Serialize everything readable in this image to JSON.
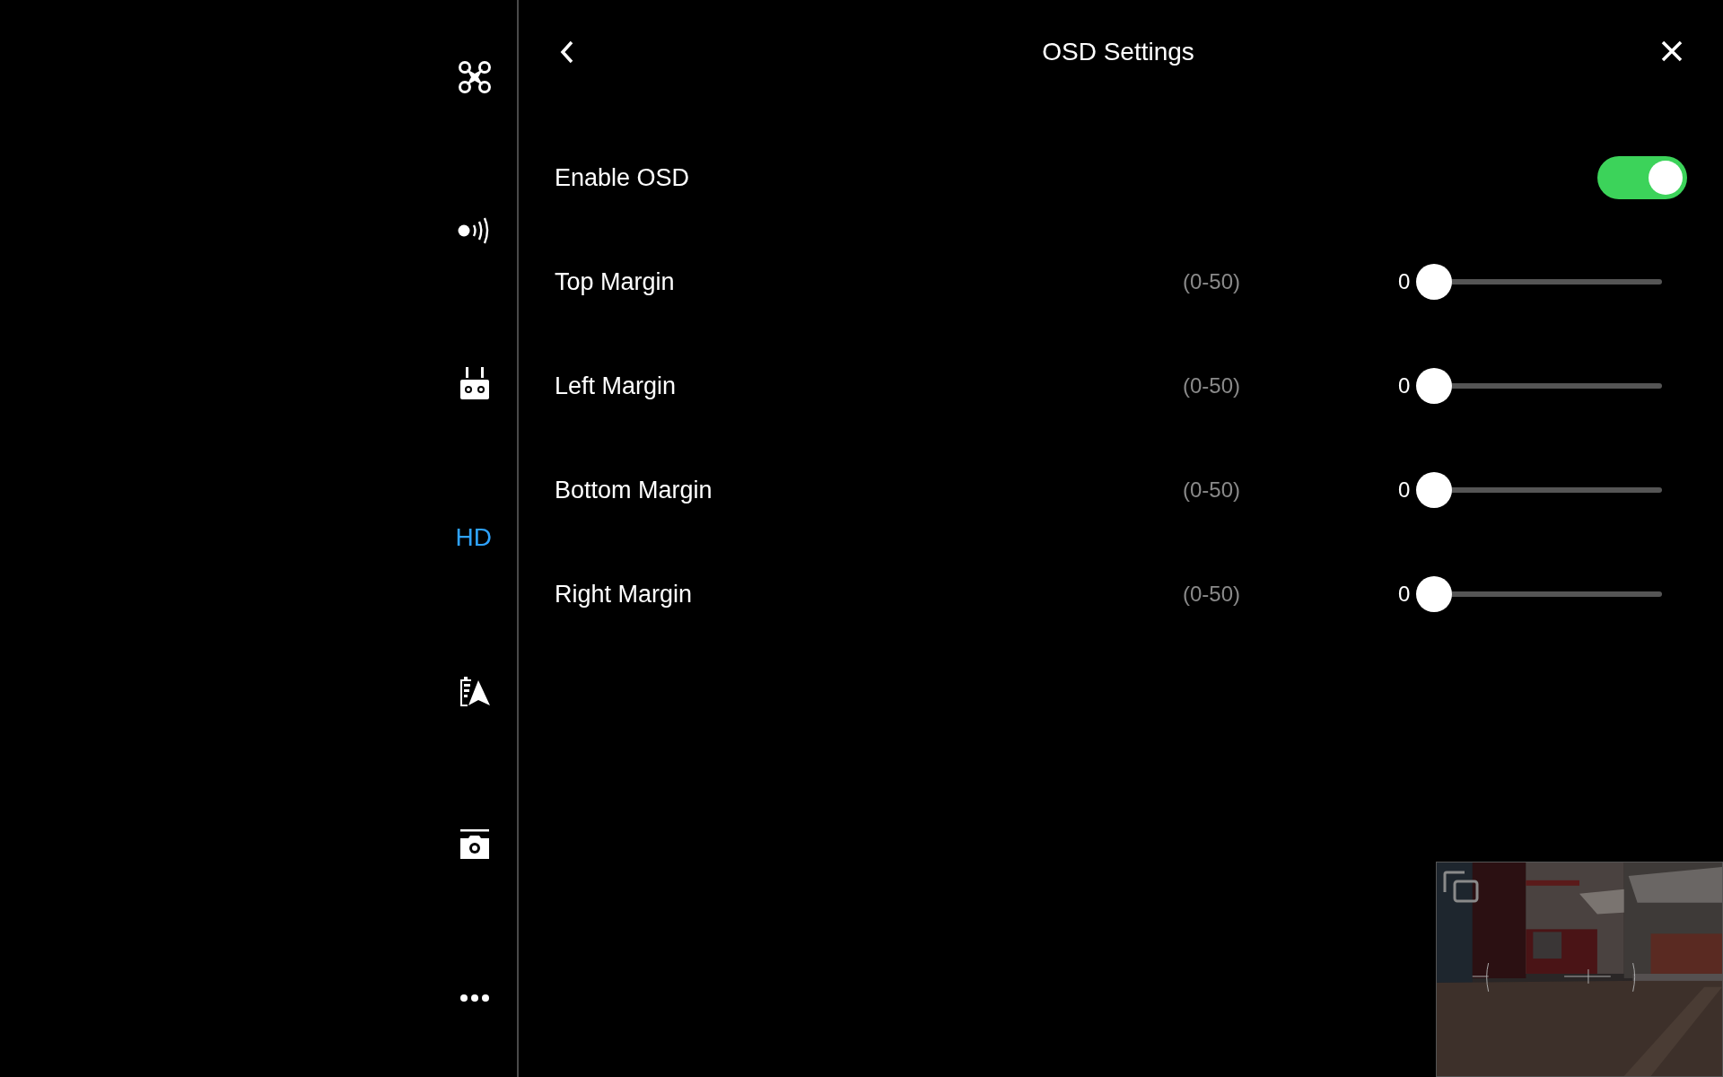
{
  "sidebar": {
    "items": [
      {
        "kind": "drone",
        "selected": false
      },
      {
        "kind": "signal",
        "selected": false
      },
      {
        "kind": "remote",
        "selected": false
      },
      {
        "kind": "text",
        "label": "HD",
        "selected": true
      },
      {
        "kind": "battery-nav",
        "selected": false
      },
      {
        "kind": "camera",
        "selected": false
      },
      {
        "kind": "more",
        "selected": false
      }
    ]
  },
  "header": {
    "title": "OSD Settings"
  },
  "settings": [
    {
      "kind": "toggle",
      "label": "Enable OSD",
      "on": true
    },
    {
      "kind": "slider",
      "label": "Top Margin",
      "range": "(0-50)",
      "value": "0",
      "level": 0
    },
    {
      "kind": "slider",
      "label": "Left Margin",
      "range": "(0-50)",
      "value": "0",
      "level": 0
    },
    {
      "kind": "slider",
      "label": "Bottom Margin",
      "range": "(0-50)",
      "value": "0",
      "level": 0
    },
    {
      "kind": "slider",
      "label": "Right Margin",
      "range": "(0-50)",
      "value": "0",
      "level": 0
    }
  ]
}
